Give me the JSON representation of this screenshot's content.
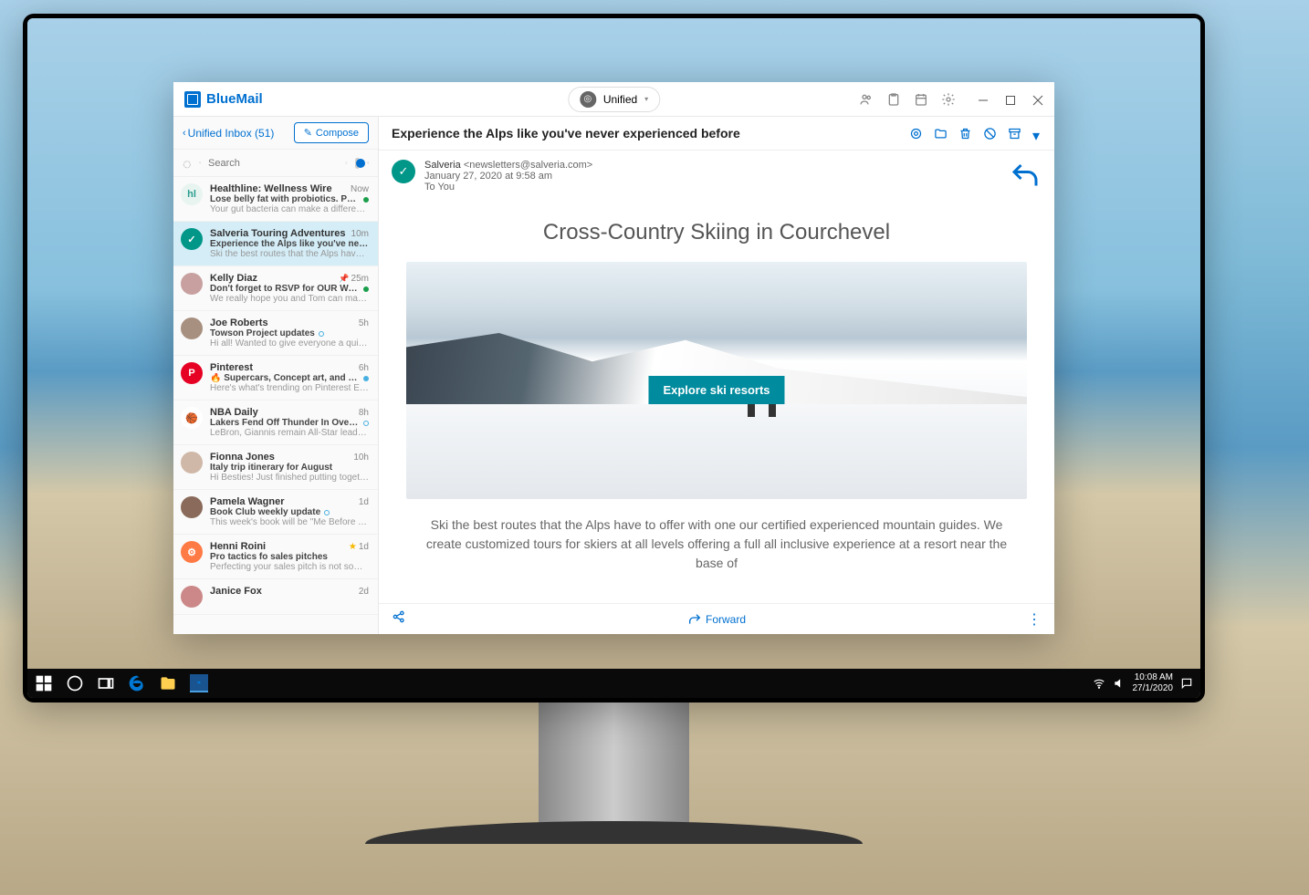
{
  "app": {
    "name": "BlueMail"
  },
  "titlebar": {
    "unified_label": "Unified"
  },
  "sidebar": {
    "inbox_label": "Unified Inbox (51)",
    "compose_label": "Compose",
    "search_placeholder": "Search"
  },
  "emails": [
    {
      "sender": "Healthline: Wellness Wire",
      "time": "Now",
      "subject": "Lose belly fat with probiotics. Power walking…",
      "preview": "Your gut bacteria can make a difference in…",
      "avatar_bg": "#e8f4f0",
      "avatar_text": "hl",
      "avatar_color": "#2a9d8f",
      "dot": "#1a9e4b",
      "selected": false
    },
    {
      "sender": "Salveria Touring Adventures",
      "time": "10m",
      "subject": "Experience the Alps like you've never experie…",
      "preview": "Ski the best routes that the Alps have to offer…",
      "avatar_bg": "#009688",
      "avatar_text": "✓",
      "avatar_color": "#fff",
      "dot": "",
      "selected": true
    },
    {
      "sender": "Kelly Diaz",
      "time": "25m",
      "subject": "Don't forget to RSVP for OUR Wedding!!",
      "preview": "We really hope you and Tom can make it!…",
      "avatar_bg": "#c8a0a0",
      "avatar_text": "",
      "avatar_color": "#fff",
      "dot": "#1a9e4b",
      "pin": true,
      "selected": false
    },
    {
      "sender": "Joe Roberts",
      "time": "5h",
      "subject": "Towson Project updates",
      "preview": "Hi all! Wanted to give everyone a quick updat…",
      "avatar_bg": "#a89080",
      "avatar_text": "",
      "dot": "#47b0e0",
      "dot_hollow": true,
      "selected": false
    },
    {
      "sender": "Pinterest",
      "time": "6h",
      "subject": "🔥 Supercars, Concept art, and more Pins…",
      "preview": "Here's what's trending on Pinterest EQ silver…",
      "avatar_bg": "#e60023",
      "avatar_text": "P",
      "avatar_color": "#fff",
      "dot": "#47b0e0",
      "selected": false
    },
    {
      "sender": "NBA Daily",
      "time": "8h",
      "subject": "Lakers Fend Off Thunder In Overtime; Take…",
      "preview": "LeBron, Giannis remain All-Star leaders >>",
      "avatar_bg": "#fff",
      "avatar_text": "🏀",
      "dot": "#47b0e0",
      "dot_hollow": true,
      "selected": false
    },
    {
      "sender": "Fionna Jones",
      "time": "10h",
      "subject": "Italy trip itinerary for August",
      "preview": "Hi Besties! Just finished putting together an…",
      "avatar_bg": "#d0b8a8",
      "avatar_text": "",
      "dot": "",
      "selected": false
    },
    {
      "sender": "Pamela Wagner",
      "time": "1d",
      "subject": "Book Club weekly update",
      "preview": "This week's book will be \"Me Before You\" by…",
      "avatar_bg": "#8a6a5a",
      "avatar_text": "",
      "dot": "#47b0e0",
      "dot_hollow": true,
      "selected": false
    },
    {
      "sender": "Henni Roini",
      "time": "1d",
      "subject": "Pro tactics fo sales pitches",
      "preview": "Perfecting your sales pitch is not something…",
      "avatar_bg": "#ff7a45",
      "avatar_text": "⚙",
      "avatar_color": "#fff",
      "dot": "",
      "star": true,
      "selected": false
    },
    {
      "sender": "Janice Fox",
      "time": "2d",
      "subject": "",
      "preview": "",
      "avatar_bg": "#c88",
      "avatar_text": "",
      "dot": "",
      "selected": false
    }
  ],
  "reading": {
    "subject": "Experience the Alps like you've never experienced before",
    "from_name": "Salveria",
    "from_email": "<newsletters@salveria.com>",
    "date": "January 27, 2020 at 9:58 am",
    "to": "To You",
    "content_title": "Cross-Country Skiing in Courchevel",
    "cta": "Explore ski resorts",
    "body_text": "Ski the best routes that the Alps have to offer with one our certified experienced mountain guides. We create customized tours for skiers at all levels offering a full all inclusive experience at a resort near the base of",
    "forward_label": "Forward"
  },
  "taskbar": {
    "time": "10:08 AM",
    "date": "27/1/2020"
  }
}
